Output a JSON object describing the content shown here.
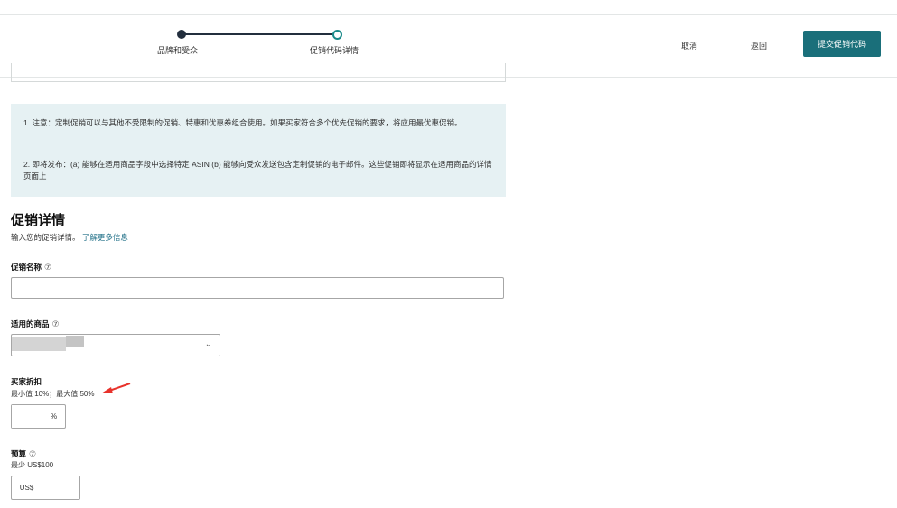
{
  "stepper": {
    "steps": [
      {
        "label": "品牌和受众",
        "status": "completed"
      },
      {
        "label": "促销代码详情",
        "status": "current"
      }
    ]
  },
  "actions": {
    "cancel": "取消",
    "back": "返回",
    "submit": "提交促销代码"
  },
  "notice": {
    "line1": "1. 注意：定制促销可以与其他不受限制的促销、特惠和优惠券组合使用。如果买家符合多个优先促销的要求，将应用最优惠促销。",
    "line2": "2. 即将发布：(a) 能够在适用商品字段中选择特定 ASIN (b) 能够向受众发送包含定制促销的电子邮件。这些促销即将显示在适用商品的详情页面上"
  },
  "section": {
    "title": "促销详情",
    "description": "输入您的促销详情。",
    "learn_more": "了解更多信息"
  },
  "fields": {
    "promo_name": {
      "label": "促销名称",
      "value": ""
    },
    "applicable_products": {
      "label": "适用的商品",
      "value": ""
    },
    "buyer_discount": {
      "label": "买家折扣",
      "hint": "最小值 10%；最大值 50%",
      "unit": "%",
      "value": ""
    },
    "budget": {
      "label": "预算",
      "hint": "最少 US$100",
      "currency": "US$",
      "value": ""
    }
  },
  "icons": {
    "help": "⑦",
    "chevron": "⌄"
  },
  "colors": {
    "accent": "#1a6f7a",
    "notice_bg": "#e6f1f3",
    "link": "#1f6f87",
    "annotation_arrow": "#e8322b"
  }
}
